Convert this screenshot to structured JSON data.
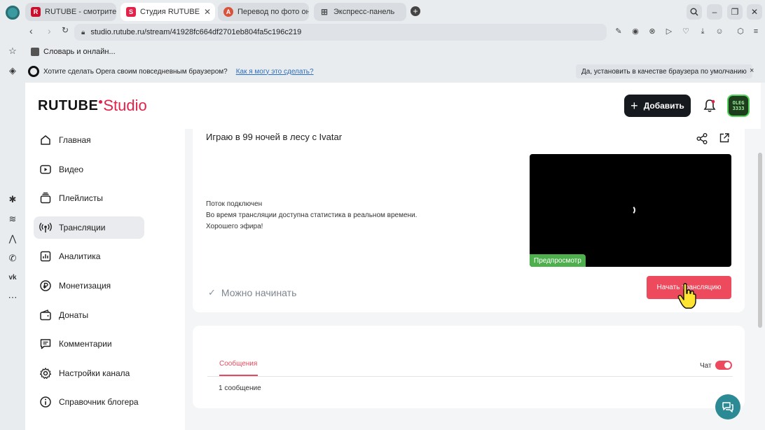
{
  "browser": {
    "tabs": [
      {
        "title": "RUTUBE - смотрите вид",
        "favicon": "rutube-icon",
        "active": false
      },
      {
        "title": "Студия RUTUBE",
        "favicon": "rutube-studio-icon",
        "active": true
      },
      {
        "title": "Перевод по фото онла",
        "favicon": "translate-icon",
        "active": false
      },
      {
        "title": "Экспресс-панель",
        "favicon": "grid-icon",
        "active": false
      }
    ],
    "url": "studio.rutube.ru/stream/41928fc664df2701eb804fa5c196c219",
    "bookmark": "Словарь и онлайн...",
    "infobar": {
      "text": "Хотите сделать Opera своим повседневным браузером?",
      "link": "Как я могу это сделать?",
      "button": "Да, установить в качестве браузера по умолчанию",
      "close": "×"
    }
  },
  "header": {
    "logo_main": "RUTUBE",
    "logo_studio": "Studio",
    "add_button": "Добавить",
    "avatar_text": "OLEG 3333"
  },
  "nav": {
    "items": [
      {
        "label": "Главная",
        "icon": "home-icon"
      },
      {
        "label": "Видео",
        "icon": "video-icon"
      },
      {
        "label": "Плейлисты",
        "icon": "playlist-icon"
      },
      {
        "label": "Трансляции",
        "icon": "broadcast-icon",
        "selected": true
      },
      {
        "label": "Аналитика",
        "icon": "analytics-icon"
      },
      {
        "label": "Монетизация",
        "icon": "ruble-icon"
      },
      {
        "label": "Донаты",
        "icon": "wallet-icon"
      },
      {
        "label": "Комментарии",
        "icon": "comment-icon"
      },
      {
        "label": "Настройки канала",
        "icon": "gear-icon"
      },
      {
        "label": "Справочник блогера",
        "icon": "info-icon"
      }
    ]
  },
  "stream": {
    "title": "Играю в 99 ночей в лесу с Ivatar",
    "status_lines": [
      "Поток подключен",
      "Во время трансляции доступна статистика в реальном времени.",
      "Хорошего эфира!"
    ],
    "preview_label": "Предпросмотр",
    "ready_text": "Можно начинать",
    "start_button": "Начать трансляцию"
  },
  "chat": {
    "tab_label": "Сообщения",
    "toggle_label": "Чат",
    "toggle_on": true,
    "message_count": "1 сообщение"
  },
  "colors": {
    "brand_red": "#e3224a",
    "start_button": "#ee4a5e",
    "preview_badge": "#4db04d",
    "help_fab": "#2c8a94"
  }
}
